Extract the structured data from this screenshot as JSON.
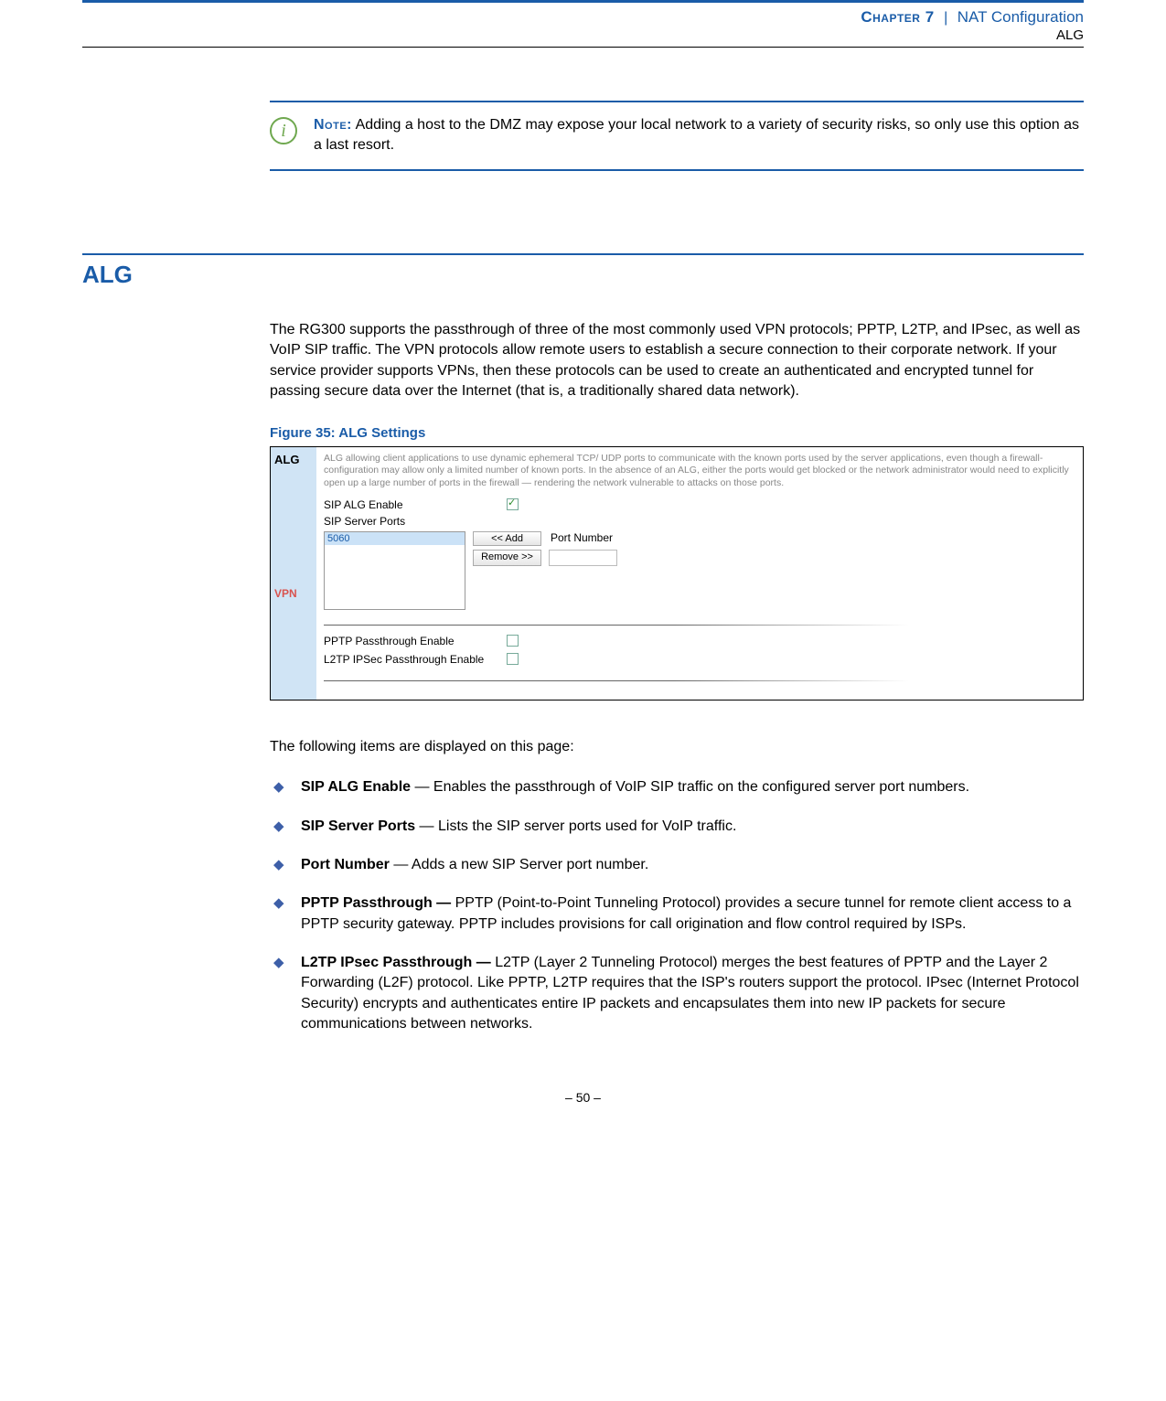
{
  "header": {
    "chapter": "Chapter 7",
    "separator": "|",
    "title": "NAT Configuration",
    "subtitle": "ALG"
  },
  "note": {
    "label": "Note:",
    "text": " Adding a host to the DMZ may expose your local network to a variety of security risks, so only use this option as a last resort."
  },
  "section": {
    "title": "ALG",
    "intro": "The RG300 supports the passthrough of three of the most commonly used VPN protocols; PPTP, L2TP, and IPsec, as well as VoIP SIP traffic. The VPN protocols allow remote users to establish a secure connection to their corporate network. If your service provider supports VPNs, then these protocols can be used to create an authenticated and encrypted tunnel for passing secure data over the Internet (that is, a traditionally shared data network)."
  },
  "figure": {
    "caption": "Figure 35:  ALG Settings",
    "side1": "ALG",
    "side2": "VPN",
    "desc": "ALG allowing client applications to use dynamic ephemeral TCP/ UDP ports to communicate with the known ports used by the server applications, even though a firewall-configuration may allow only a limited number of known ports. In the absence of an ALG, either the ports would get blocked or the network administrator would need to explicitly open up a large number of ports in the firewall — rendering the network vulnerable to attacks on those ports.",
    "sip_enable_label": "SIP ALG Enable",
    "sip_ports_label": "SIP Server Ports",
    "port_list_item": "5060",
    "btn_add": "<< Add",
    "btn_remove": "Remove >>",
    "port_number_label": "Port Number",
    "pptp_label": "PPTP Passthrough Enable",
    "l2tp_label": "L2TP IPSec Passthrough Enable"
  },
  "after_figure": "The following items are displayed on this page:",
  "items": [
    {
      "title": "SIP ALG Enable",
      "sep": " — ",
      "text": "Enables the passthrough of VoIP SIP traffic on the configured server port numbers."
    },
    {
      "title": "SIP Server Ports",
      "sep": " — ",
      "text": "Lists the SIP server ports used for VoIP traffic."
    },
    {
      "title": "Port Number",
      "sep": " — ",
      "text": "Adds a new SIP Server port number."
    },
    {
      "title": "PPTP Passthrough — ",
      "sep": "",
      "text": "PPTP (Point-to-Point Tunneling Protocol) provides a secure tunnel for remote client access to a PPTP security gateway. PPTP includes provisions for call origination and flow control required by ISPs."
    },
    {
      "title": "L2TP IPsec Passthrough — ",
      "sep": " ",
      "text": "L2TP (Layer 2 Tunneling Protocol) merges the best features of PPTP and the Layer 2 Forwarding (L2F) protocol. Like PPTP, L2TP requires that the ISP's routers support the protocol. IPsec (Internet Protocol Security) encrypts and authenticates entire IP packets and encapsulates them into new IP packets for secure communications between networks."
    }
  ],
  "footer": "–  50  –"
}
